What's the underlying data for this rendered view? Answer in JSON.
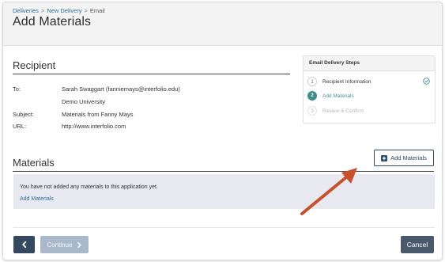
{
  "breadcrumb": [
    "Deliveries",
    "New Delivery",
    "Email"
  ],
  "page_title": "Add Materials",
  "recipient": {
    "title": "Recipient",
    "rows": [
      {
        "label": "To:",
        "value": "Sarah Swaggart (fanniemays@interfolio.edu)"
      },
      {
        "label": "",
        "value": "Demo University"
      },
      {
        "label": "Subject:",
        "value": "Materials from Fanny Mays"
      },
      {
        "label": "URL:",
        "value": "http://www.interfolio.com"
      }
    ]
  },
  "steps": {
    "title": "Email Delivery Steps",
    "items": [
      {
        "num": "1",
        "label": "Recipient Information",
        "state": "complete"
      },
      {
        "num": "2",
        "label": "Add Materials",
        "state": "active"
      },
      {
        "num": "3",
        "label": "Review & Confirm",
        "state": "disabled"
      }
    ]
  },
  "materials": {
    "title": "Materials",
    "add_button_label": "Add Materials",
    "empty_message": "You have not added any materials to this application yet.",
    "empty_link": "Add Materials"
  },
  "footer": {
    "continue_label": "Continue",
    "cancel_label": "Cancel"
  },
  "colors": {
    "accent": "#3f8f88",
    "link": "#2e6e9e",
    "primary_dark": "#34485f",
    "annotation_arrow": "#c8502a"
  },
  "icons": [
    "chevron-left-icon",
    "chevron-right-icon",
    "plus-square-icon",
    "check-circle-icon",
    "annotation-arrow"
  ]
}
